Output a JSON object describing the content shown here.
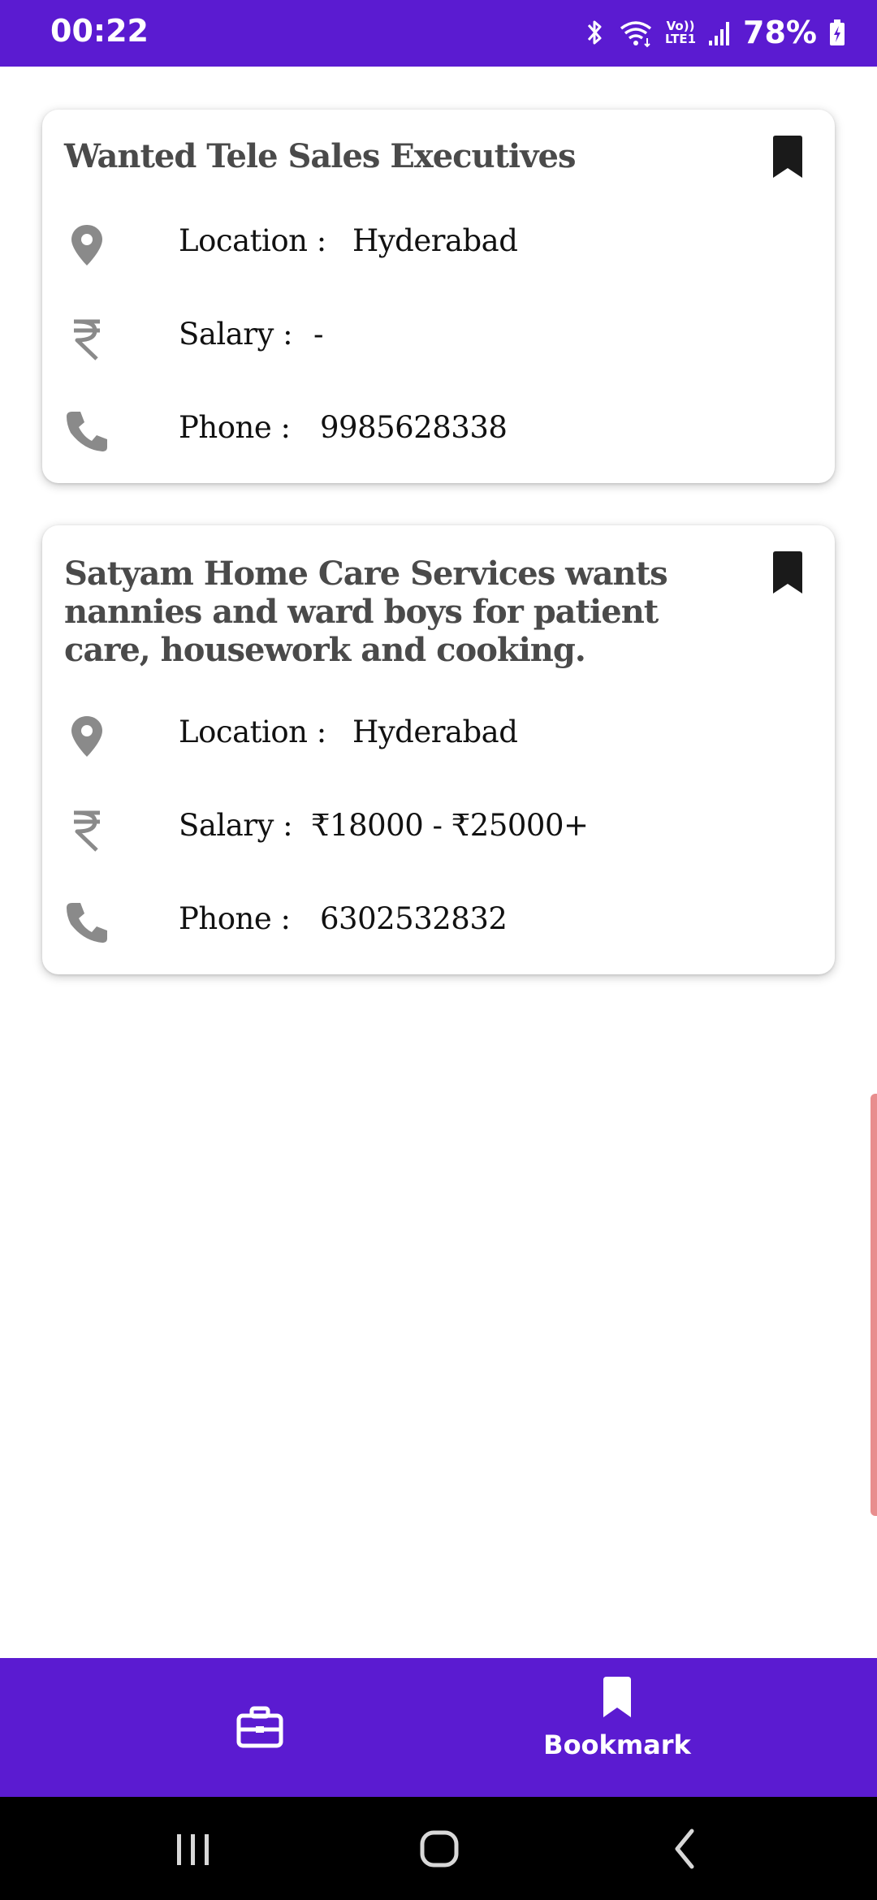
{
  "status_bar": {
    "time": "00:22",
    "lte_line1": "Vo))",
    "lte_line2": "LTE1",
    "battery": "78%"
  },
  "jobs": [
    {
      "title": "Wanted Tele Sales Executives",
      "location_label": "Location :",
      "location": "Hyderabad",
      "salary_label": "Salary :",
      "salary": "-",
      "phone_label": "Phone :",
      "phone": "9985628338",
      "bookmarked": true
    },
    {
      "title": "Satyam Home Care Services wants nannies and ward boys for patient care, housework and cooking.",
      "location_label": "Location :",
      "location": "Hyderabad",
      "salary_label": "Salary :",
      "salary": "₹18000 - ₹25000+",
      "phone_label": "Phone :",
      "phone": "6302532832",
      "bookmarked": true
    }
  ],
  "bottom_nav": {
    "jobs_icon": "briefcase-icon",
    "bookmark_icon": "bookmark-icon",
    "bookmark_label": "Bookmark",
    "active": "bookmark"
  },
  "colors": {
    "primary": "#5b1bd1",
    "icon_gray": "#8a8a8a",
    "title_gray": "#4a4a4a"
  }
}
